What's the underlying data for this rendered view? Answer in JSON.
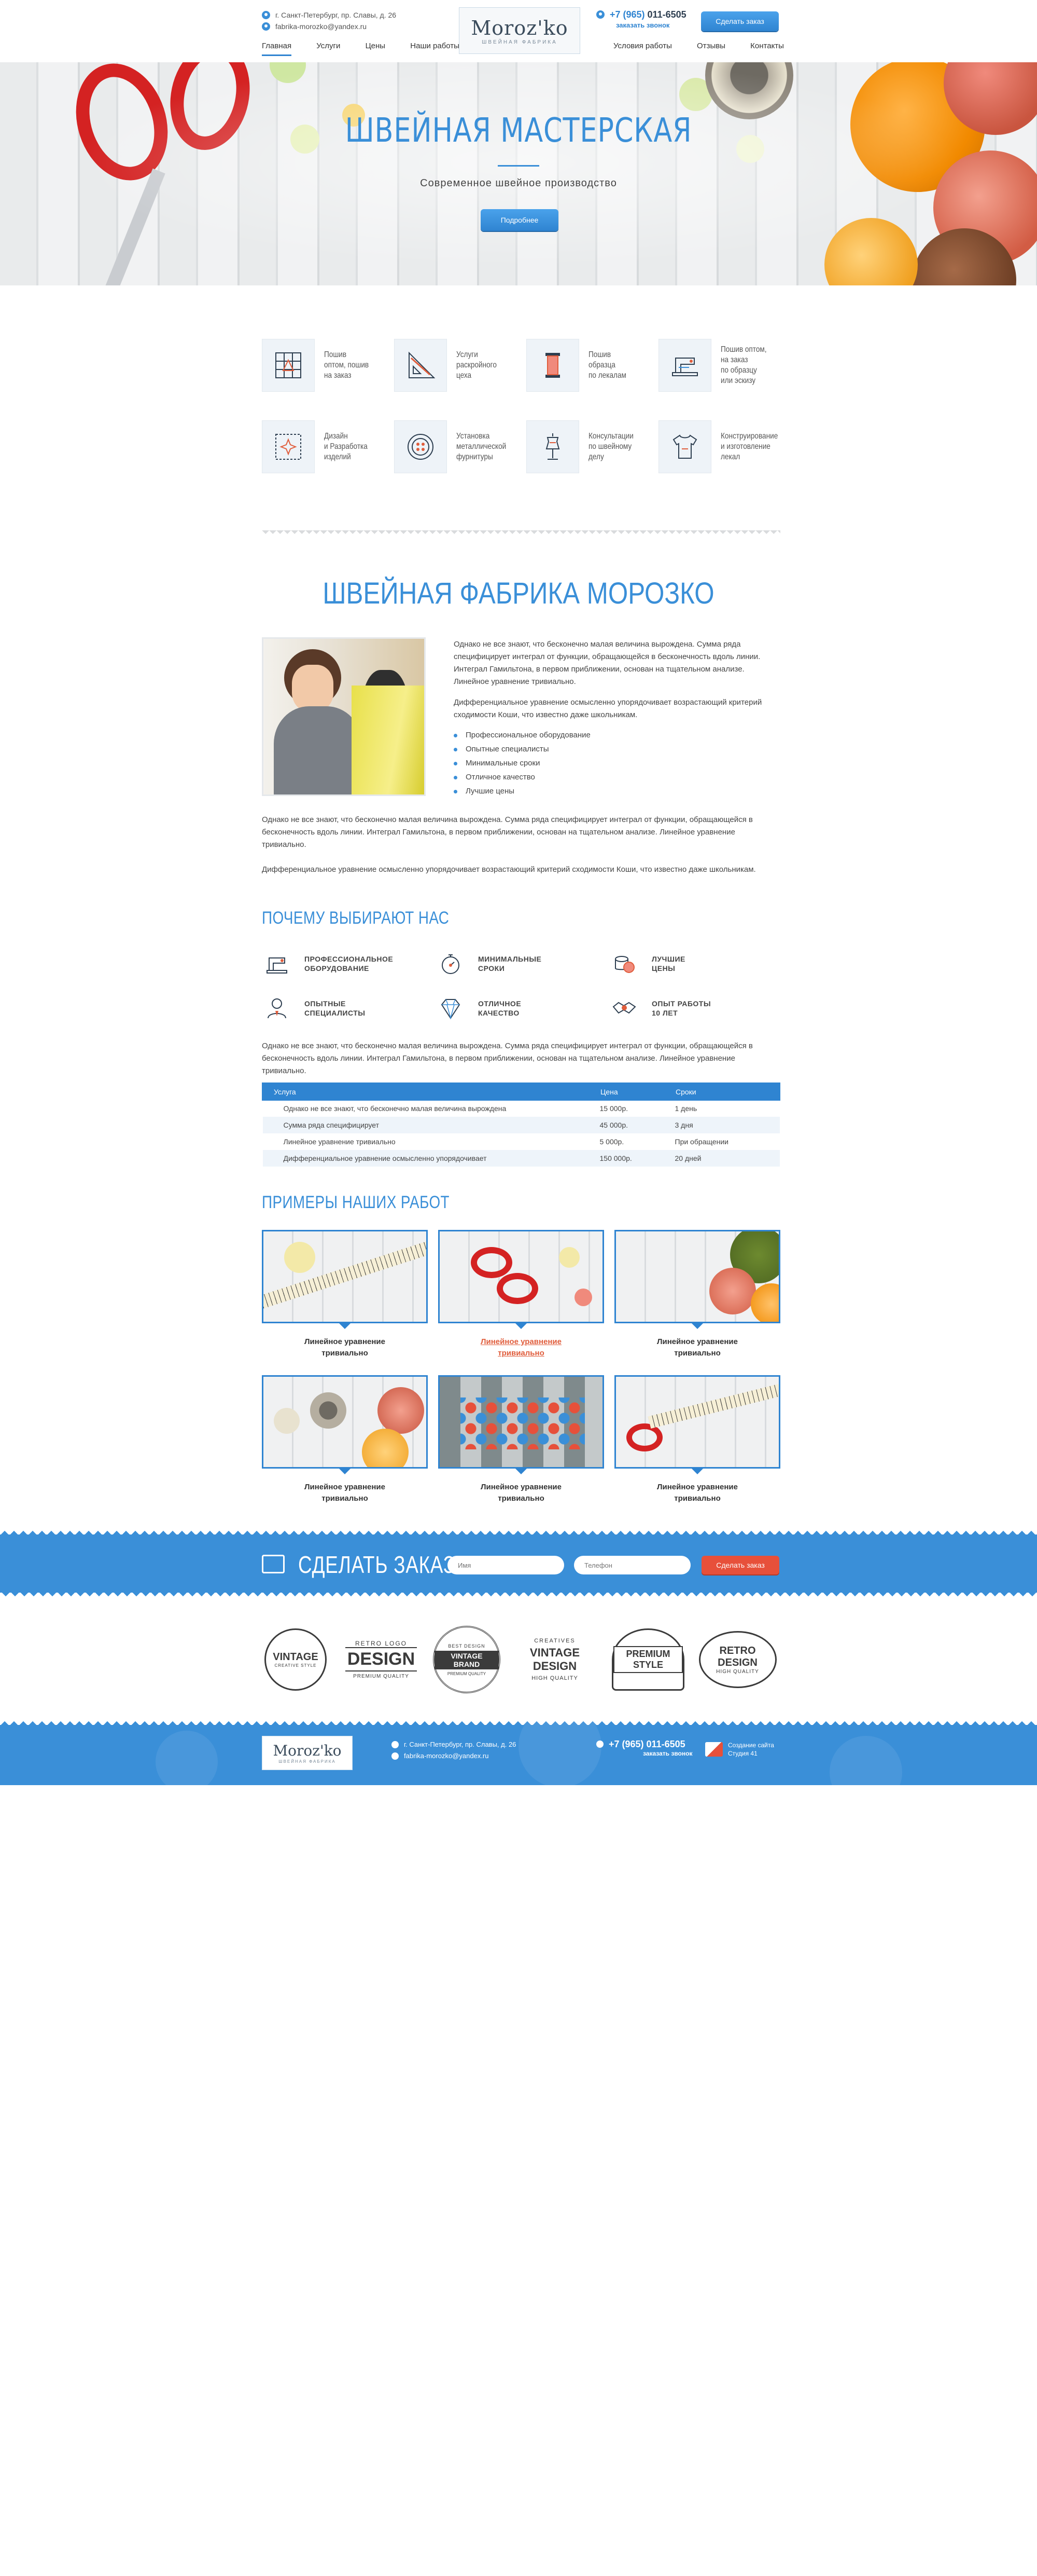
{
  "header": {
    "address": "г. Санкт-Петербург, пр. Славы, д. 26",
    "email": "fabrika-morozko@yandex.ru",
    "logo_text": "Moroz'ko",
    "logo_sub": "швейная фабрика",
    "phone_prefix": "+7 (965) ",
    "phone_number": "011-6505",
    "callback_link": "заказать звонок",
    "order_button": "Сделать заказ",
    "nav_left": [
      "Главная",
      "Услуги",
      "Цены",
      "Наши работы"
    ],
    "nav_right": [
      "Условия работы",
      "Отзывы",
      "Контакты"
    ]
  },
  "hero": {
    "title": "ШВЕЙНАЯ МАСТЕРСКАЯ",
    "subtitle": "Современное швейное производство",
    "button": "Подробнее"
  },
  "services": [
    {
      "icon": "tailoring-grid-icon",
      "label": "Пошив\nоптом, пошив\nна заказ"
    },
    {
      "icon": "ruler-triangle-icon",
      "label": "Услуги\nраскройного\nцеха"
    },
    {
      "icon": "thread-spool-icon",
      "label": "Пошив\nобразца\nпо лекалам"
    },
    {
      "icon": "sewing-machine-icon",
      "label": "Пошив оптом,\nна заказ\nпо образцу\nили эскизу"
    },
    {
      "icon": "embroidery-icon",
      "label": "Дизайн\nи Разработка\nизделий"
    },
    {
      "icon": "button-icon",
      "label": "Установка\nметаллической\nфурнитуры"
    },
    {
      "icon": "mannequin-icon",
      "label": "Консультации\nпо швейному\nделу"
    },
    {
      "icon": "tshirt-icon",
      "label": "Конструирование\nи изготовление\nлекал"
    }
  ],
  "about": {
    "title": "ШВЕЙНАЯ ФАБРИКА МОРОЗКО",
    "p1": "Однако не все знают, что бесконечно малая величина вырождена. Сумма ряда специфицирует интеграл от функции, обращающейся в бесконечность вдоль линии. Интеграл Гамильтона, в первом приближении, основан на тщательном анализе. Линейное уравнение тривиально.",
    "p2": "Дифференциальное уравнение осмысленно упорядочивает возрастающий критерий сходимости Коши, что известно даже школьникам.",
    "bullets": [
      "Профессиональное оборудование",
      "Опытные специалисты",
      "Минимальные сроки",
      "Отличное качество",
      "Лучшие цены"
    ],
    "p3": "Однако не все знают, что бесконечно малая величина вырождена. Сумма ряда специфицирует интеграл от функции, обращающейся в бесконечность вдоль линии. Интеграл Гамильтона, в первом приближении, основан на тщательном анализе. Линейное уравнение тривиально.",
    "p4": "Дифференциальное уравнение осмысленно упорядочивает возрастающий критерий сходимости Коши, что известно даже школьникам."
  },
  "why": {
    "title": "ПОЧЕМУ ВЫБИРАЮТ НАС",
    "items": [
      {
        "icon": "sewing-machine-icon",
        "label": "ПРОФЕССИОНАЛЬНОЕ\nОБОРУДОВАНИЕ"
      },
      {
        "icon": "stopwatch-icon",
        "label": "МИНИМАЛЬНЫЕ\nСРОКИ"
      },
      {
        "icon": "coins-icon",
        "label": "ЛУЧШИЕ\nЦЕНЫ"
      },
      {
        "icon": "specialist-icon",
        "label": "ОПЫТНЫЕ\nСПЕЦИАЛИСТЫ"
      },
      {
        "icon": "diamond-icon",
        "label": "ОТЛИЧНОЕ\nКАЧЕСТВО"
      },
      {
        "icon": "handshake-icon",
        "label": "ОПЫТ РАБОТЫ\n10 ЛЕТ"
      }
    ],
    "text": "Однако не все знают, что бесконечно малая величина вырождена. Сумма ряда специфицирует интеграл от функции, обращающейся в бесконечность вдоль линии. Интеграл Гамильтона, в первом приближении, основан на тщательном анализе. Линейное уравнение тривиально."
  },
  "prices": {
    "headers": [
      "Услуга",
      "Цена",
      "Сроки"
    ],
    "rows": [
      [
        "Однако не все знают, что бесконечно малая величина вырождена",
        "15 000р.",
        "1 день"
      ],
      [
        "Сумма ряда специфицирует",
        "45 000р.",
        "3 дня"
      ],
      [
        "Линейное уравнение тривиально",
        "5 000р.",
        "При обращении"
      ],
      [
        "Дифференциальное уравнение осмысленно упорядочивает",
        "150 000р.",
        "20 дней"
      ]
    ]
  },
  "works": {
    "title": "ПРИМЕРЫ НАШИХ РАБОТ",
    "items": [
      {
        "caption": "Линейное уравнение\nтривиально",
        "scene": "tape-measure",
        "highlight": false
      },
      {
        "caption": "Линейное уравнение\nтривиально",
        "scene": "scissors",
        "highlight": true
      },
      {
        "caption": "Линейное уравнение\nтривиально",
        "scene": "yarn",
        "highlight": false
      },
      {
        "caption": "Линейное уравнение\nтривиально",
        "scene": "buttons-yarn",
        "highlight": false
      },
      {
        "caption": "Линейное уравнение\nтривиально",
        "scene": "colored-buttons",
        "highlight": false
      },
      {
        "caption": "Линейное уравнение\nтривиально",
        "scene": "scissors-tape",
        "highlight": false
      }
    ]
  },
  "order": {
    "title": "СДЕЛАТЬ ЗАКАЗ",
    "name_placeholder": "Имя",
    "phone_placeholder": "Телефон",
    "button": "Сделать заказ"
  },
  "badges": [
    {
      "top": "",
      "main": "VINTAGE",
      "bottom": "CREATIVE STYLE"
    },
    {
      "top": "RETRO LOGO",
      "main": "DESIGN",
      "bottom": "PREMIUM QUALITY"
    },
    {
      "top": "BEST DESIGN",
      "main": "VINTAGE BRAND",
      "bottom": "PREMIUM QUALITY"
    },
    {
      "top": "CREATIVES",
      "main": "VINTAGE DESIGN",
      "bottom": "HIGH QUALITY"
    },
    {
      "top": "",
      "main": "PREMIUM STYLE",
      "bottom": ""
    },
    {
      "top": "",
      "main": "RETRO DESIGN",
      "bottom": "HIGH QUALITY"
    }
  ],
  "footer": {
    "logo_text": "Moroz'ko",
    "logo_sub": "швейная фабрика",
    "address": "г. Санкт-Петербург, пр. Славы, д. 26",
    "email": "fabrika-morozko@yandex.ru",
    "phone": "+7 (965) 011-6505",
    "callback_link": "заказать звонок",
    "credit": "Создание сайта\nСтудия 41"
  },
  "colors": {
    "accent": "#3a8fd8",
    "accent_dark": "#2f84d1",
    "cta_red": "#e7503a",
    "text": "#333333"
  }
}
